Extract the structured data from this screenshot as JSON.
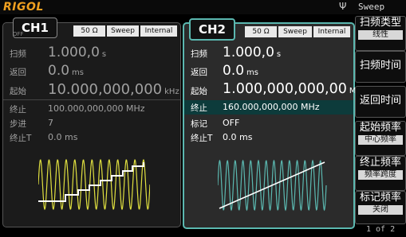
{
  "topbar": {
    "brand": "RIGOL",
    "usb_glyph": "Ψ",
    "mode_title": "Sweep"
  },
  "ch1": {
    "tag": "CH1",
    "state": "OFF",
    "impedance": "50 Ω",
    "mode": "Sweep",
    "source": "Internal",
    "rows": {
      "sweep_time": {
        "label": "扫频",
        "value": "1.000,0",
        "unit": "s"
      },
      "return_time": {
        "label": "返回",
        "value": "0.0",
        "unit": "ms"
      },
      "start": {
        "label": "起始",
        "value": "10.000,000,000",
        "unit": "kHz"
      },
      "stop": {
        "label": "终止",
        "value": "100.000,000,000 MHz"
      },
      "step": {
        "label": "步进",
        "value": "7"
      },
      "stop_time": {
        "label": "终止T",
        "value": "0.0 ms"
      }
    }
  },
  "ch2": {
    "tag": "CH2",
    "impedance": "50 Ω",
    "mode": "Sweep",
    "source": "Internal",
    "rows": {
      "sweep_time": {
        "label": "扫频",
        "value": "1.000,0",
        "unit": "s"
      },
      "return_time": {
        "label": "返回",
        "value": "0.0",
        "unit": "ms"
      },
      "start": {
        "label": "起始",
        "value": "1.000,000,000,00",
        "unit": "MHz"
      },
      "stop": {
        "label": "终止",
        "value": "160.000,000,000 MHz"
      },
      "marker": {
        "label": "标记",
        "value": "OFF"
      },
      "stop_time": {
        "label": "终止T",
        "value": "0.0 ms"
      }
    }
  },
  "menu": {
    "sweep_type": {
      "label": "扫频类型",
      "sub": "线性"
    },
    "sweep_time": {
      "label": "扫频时间"
    },
    "return_time": {
      "label": "返回时间"
    },
    "start_freq": {
      "label": "起始频率",
      "sub": "中心频率"
    },
    "stop_freq": {
      "label": "终止频率",
      "sub": "频率跨度"
    },
    "marker_freq": {
      "label": "标记频率",
      "sub": "关闭"
    },
    "page": "1 of 2"
  },
  "colors": {
    "wave_yellow": "#e0e040",
    "ch2_accent": "#5bb8b0",
    "brand": "#f0a020",
    "highlight_row": "#0d3b3b"
  }
}
